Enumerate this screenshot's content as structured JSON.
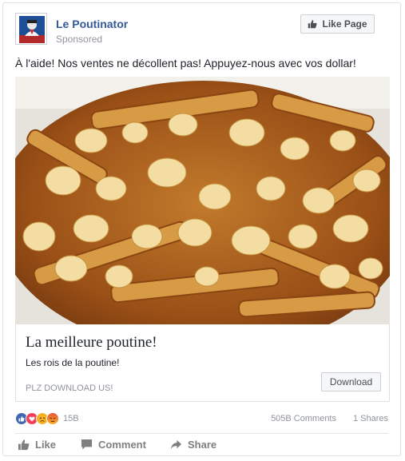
{
  "page": {
    "name": "Le Poutinator",
    "sponsored_label": "Sponsored",
    "like_page_label": "Like Page"
  },
  "post": {
    "text": "À l'aide! Nos ventes ne décollent pas! Appuyez-nous avec vos dollar!"
  },
  "ad": {
    "image_subject": "poutine",
    "headline": "La meilleure poutine!",
    "description": "Les rois de la poutine!",
    "caption": "PLZ DOWNLOAD US!",
    "cta_label": "Download"
  },
  "engagement": {
    "reactions": [
      {
        "name": "like",
        "color": "#4267b2"
      },
      {
        "name": "love",
        "color": "#f33e58"
      },
      {
        "name": "sad",
        "color": "#f7b125"
      },
      {
        "name": "angry",
        "color": "#e9710f"
      }
    ],
    "reaction_count": "15B",
    "comments": "505B Comments",
    "shares": "1 Shares"
  },
  "actions": {
    "like": "Like",
    "comment": "Comment",
    "share": "Share"
  },
  "colors": {
    "link_blue": "#365899",
    "muted_gray": "#90949c",
    "border": "#dddfe2"
  }
}
